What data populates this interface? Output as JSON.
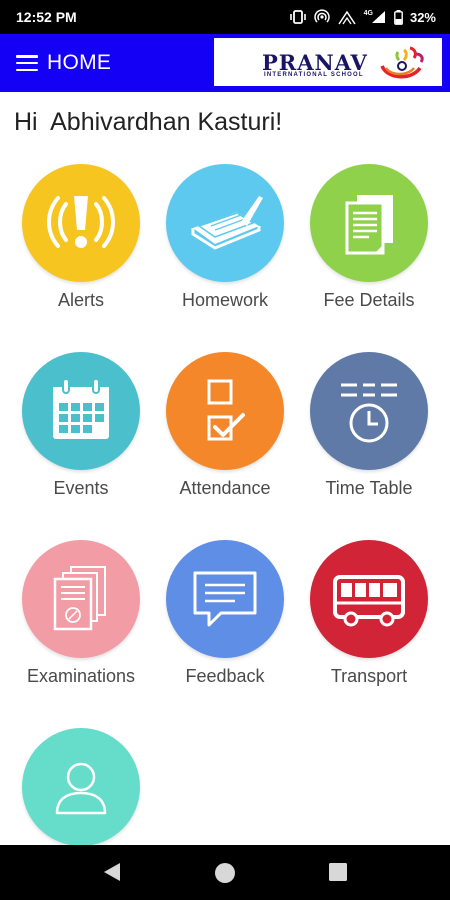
{
  "status_bar": {
    "time": "12:52 PM",
    "network_label": "4G",
    "battery_percent": "32%"
  },
  "app_bar": {
    "title": "HOME",
    "logo": {
      "name": "PRANAV",
      "subtitle": "INTERNATIONAL SCHOOL"
    }
  },
  "greeting": "Hi  Abhivardhan Kasturi!",
  "tiles": [
    {
      "label": "Alerts",
      "icon": "alert-icon",
      "color": "#f7c51f"
    },
    {
      "label": "Homework",
      "icon": "homework-icon",
      "color": "#5ec9ee"
    },
    {
      "label": "Fee Details",
      "icon": "fee-details-icon",
      "color": "#8fd14a"
    },
    {
      "label": "Events",
      "icon": "calendar-icon",
      "color": "#4cbfcc"
    },
    {
      "label": "Attendance",
      "icon": "attendance-icon",
      "color": "#f5872b"
    },
    {
      "label": "Time Table",
      "icon": "timetable-icon",
      "color": "#5f7aa6"
    },
    {
      "label": "Examinations",
      "icon": "examinations-icon",
      "color": "#f29ca5"
    },
    {
      "label": "Feedback",
      "icon": "feedback-icon",
      "color": "#5f8ee6"
    },
    {
      "label": "Transport",
      "icon": "bus-icon",
      "color": "#d22437"
    },
    {
      "label": "",
      "icon": "profile-icon",
      "color": "#66dccb"
    }
  ],
  "colors": {
    "app_bar": "#1400f5",
    "status_bar": "#000000"
  }
}
